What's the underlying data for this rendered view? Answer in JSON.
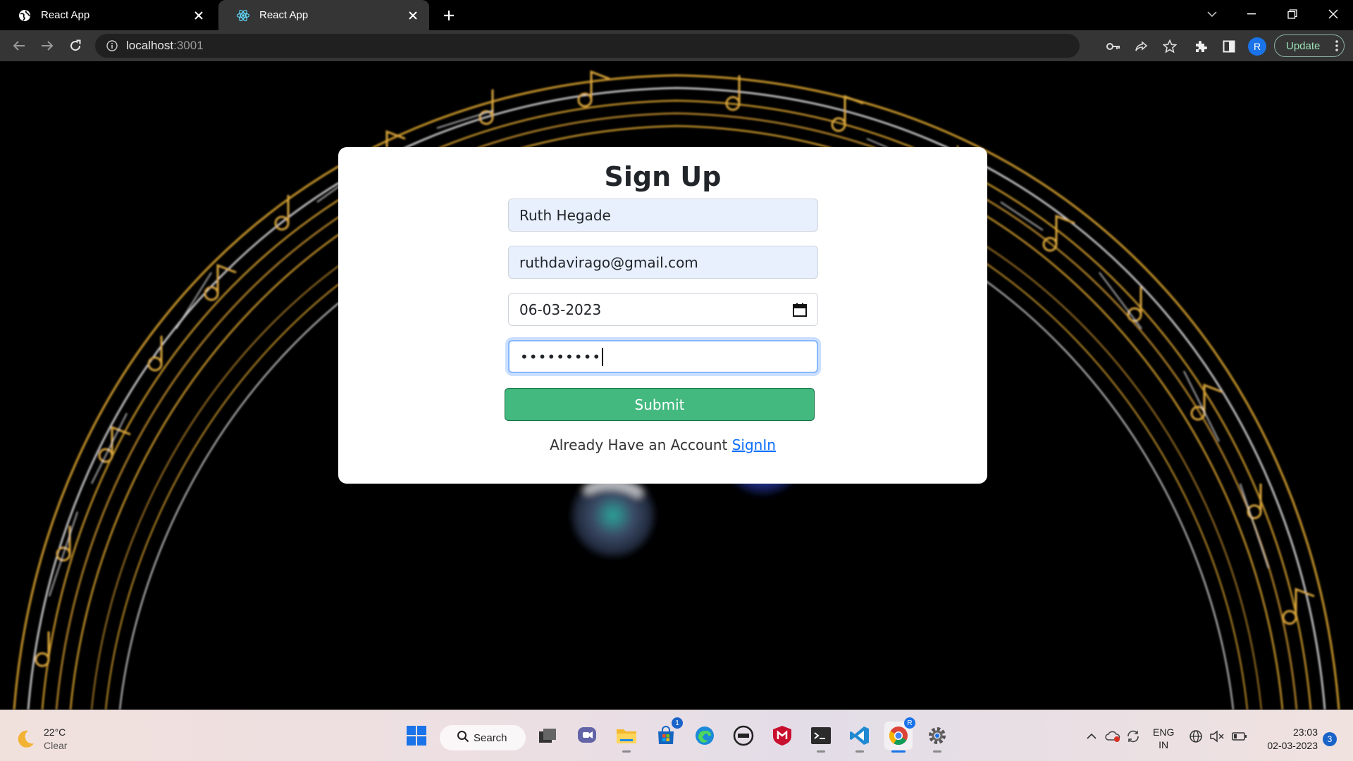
{
  "tabs": [
    {
      "title": "React App",
      "favicon": "globe-icon"
    },
    {
      "title": "React App",
      "favicon": "react-icon"
    }
  ],
  "address_bar": {
    "host": "localhost",
    "port": ":3001"
  },
  "profile": {
    "initial": "R"
  },
  "update_button": {
    "label": "Update"
  },
  "form": {
    "title": "Sign Up",
    "name_value": "Ruth Hegade",
    "email_value": "ruthdavirago@gmail.com",
    "date_value": "06-03-2023",
    "password_masked": "•••••••••",
    "submit_label": "Submit",
    "signin_prompt": "Already Have an Account",
    "signin_link": "SignIn"
  },
  "taskbar": {
    "weather_temp": "22°C",
    "weather_cond": "Clear",
    "search_label": "Search",
    "store_badge": "1",
    "chrome_badge": "R",
    "lang_line1": "ENG",
    "lang_line2": "IN",
    "time": "23:03",
    "date": "02-03-2023",
    "notifications": "3"
  },
  "colors": {
    "submit": "#43b97f",
    "link": "#0d6efd",
    "autofill": "#e8f0fe",
    "chrome_dark": "#353535",
    "arc_gold": "#c9962b"
  }
}
